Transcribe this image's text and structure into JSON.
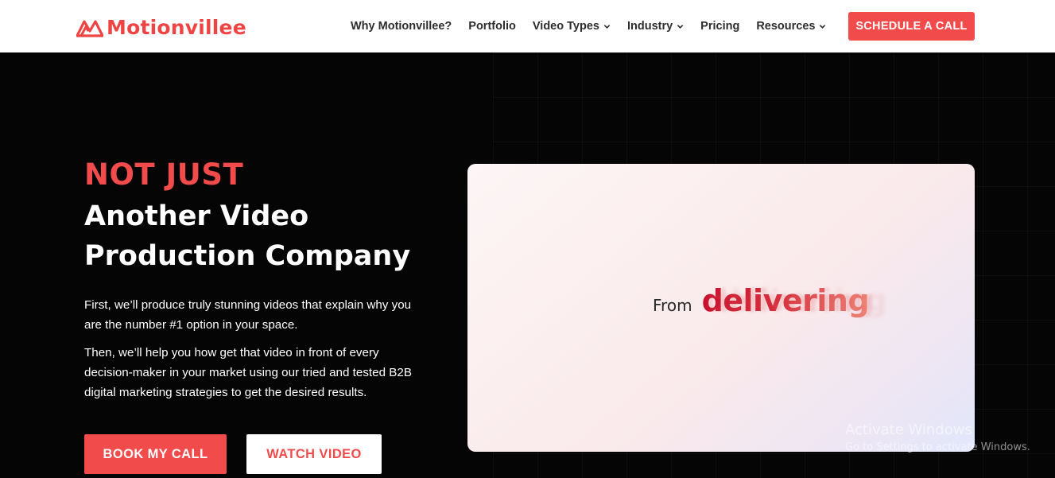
{
  "brand": {
    "name": "Motionvillee",
    "logo_icon": "triangle-m-logo-icon",
    "accent_color": "#f24b4b"
  },
  "nav": {
    "items": [
      {
        "label": "Why Motionvillee?",
        "dropdown": false
      },
      {
        "label": "Portfolio",
        "dropdown": false
      },
      {
        "label": "Video Types",
        "dropdown": true
      },
      {
        "label": "Industry",
        "dropdown": true
      },
      {
        "label": "Pricing",
        "dropdown": false
      },
      {
        "label": "Resources",
        "dropdown": true
      }
    ],
    "cta_label": "SCHEDULE A CALL"
  },
  "hero": {
    "headline_highlight": "NOT JUST",
    "headline_line1": "Another Video",
    "headline_line2": "Production Company",
    "paragraph1": "First, we’ll produce truly stunning videos that explain why you are the number #1 option in your space.",
    "paragraph2": "Then, we’ll help you how get that video in front of every decision-maker in your market using our tried and tested B2B digital marketing strategies to get the desired results.",
    "primary_button": "BOOK MY CALL",
    "secondary_button": "WATCH VIDEO",
    "video_text_prefix": "From",
    "video_text_word": "delivering"
  },
  "watermark": {
    "title": "Activate Windows",
    "subtitle": "Go to Settings to activate Windows."
  }
}
